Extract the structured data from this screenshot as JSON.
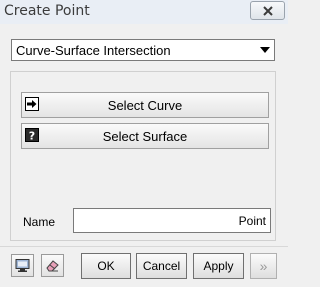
{
  "window": {
    "title": "Create Point",
    "close_icon": "close-icon"
  },
  "method": {
    "selected": "Curve-Surface Intersection",
    "arrow_icon": "chevron-down-icon"
  },
  "select_curve": {
    "label": "Select Curve",
    "icon": "arrow-right-icon"
  },
  "select_surface": {
    "label": "Select Surface",
    "icon": "question-mark-icon"
  },
  "name": {
    "label": "Name",
    "value": "Point"
  },
  "footer": {
    "ok": "OK",
    "cancel": "Cancel",
    "apply": "Apply",
    "more": "»",
    "icons": [
      "monitor-icon",
      "eraser-icon"
    ]
  }
}
